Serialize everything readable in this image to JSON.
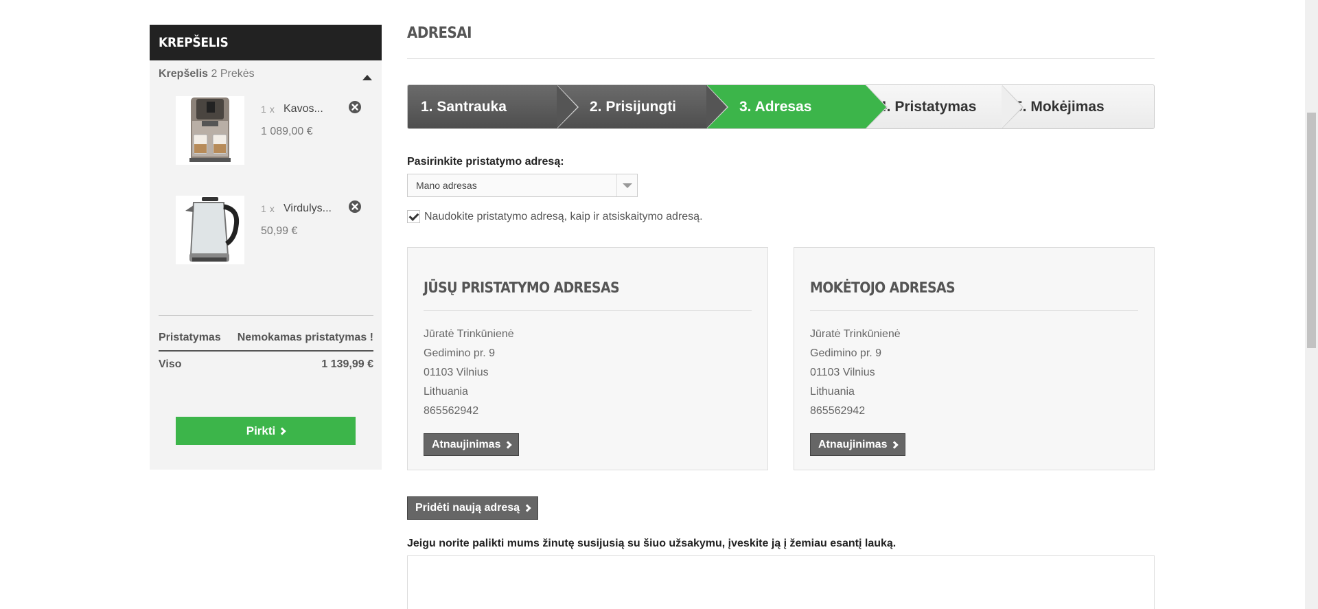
{
  "sidebar": {
    "title": "KREPŠELIS",
    "summary_label": "Krepšelis",
    "summary_count": "2 Prekės",
    "items": [
      {
        "qty": "1",
        "qty_x": "x",
        "name": "Kavos...",
        "price": "1 089,00 €",
        "icon": "coffee-machine"
      },
      {
        "qty": "1",
        "qty_x": "x",
        "name": "Virdulys...",
        "price": "50,99 €",
        "icon": "kettle"
      }
    ],
    "shipping_label": "Pristatymas",
    "shipping_value": "Nemokamas pristatymas !",
    "total_label": "Viso",
    "total_value": "1 139,99 €",
    "buy_label": "Pirkti"
  },
  "main": {
    "title": "ADRESAI",
    "steps": [
      {
        "label": "1. Santrauka",
        "state": "done"
      },
      {
        "label": "2. Prisijungti",
        "state": "done"
      },
      {
        "label": "3. Adresas",
        "state": "active"
      },
      {
        "label": "4. Pristatymas",
        "state": "todo"
      },
      {
        "label": "5. Mokėjimas",
        "state": "todo"
      }
    ],
    "select_label": "Pasirinkite pristatymo adresą:",
    "select_value": "Mano adresas",
    "same_address_label": "Naudokite pristatymo adresą, kaip ir atsiskaitymo adresą.",
    "same_address_checked": true,
    "delivery": {
      "title": "JŪSŲ PRISTATYMO ADRESAS",
      "lines": [
        "Jūratė Trinkūnienė",
        "Gedimino pr. 9",
        "01103 Vilnius",
        "Lithuania",
        "865562942"
      ],
      "update_label": "Atnaujinimas"
    },
    "billing": {
      "title": "MOKĖTOJO ADRESAS",
      "lines": [
        "Jūratė Trinkūnienė",
        "Gedimino pr. 9",
        "01103 Vilnius",
        "Lithuania",
        "865562942"
      ],
      "update_label": "Atnaujinimas"
    },
    "add_address_label": "Pridėti naują adresą",
    "message_label": "Jeigu norite palikti mums žinutę susijusią su šiuo užsakymu, įveskite ją į žemiau esantį lauką.",
    "message_value": ""
  },
  "colors": {
    "accent_green": "#3cb54a",
    "dark": "#222222",
    "button_gray": "#666666"
  }
}
